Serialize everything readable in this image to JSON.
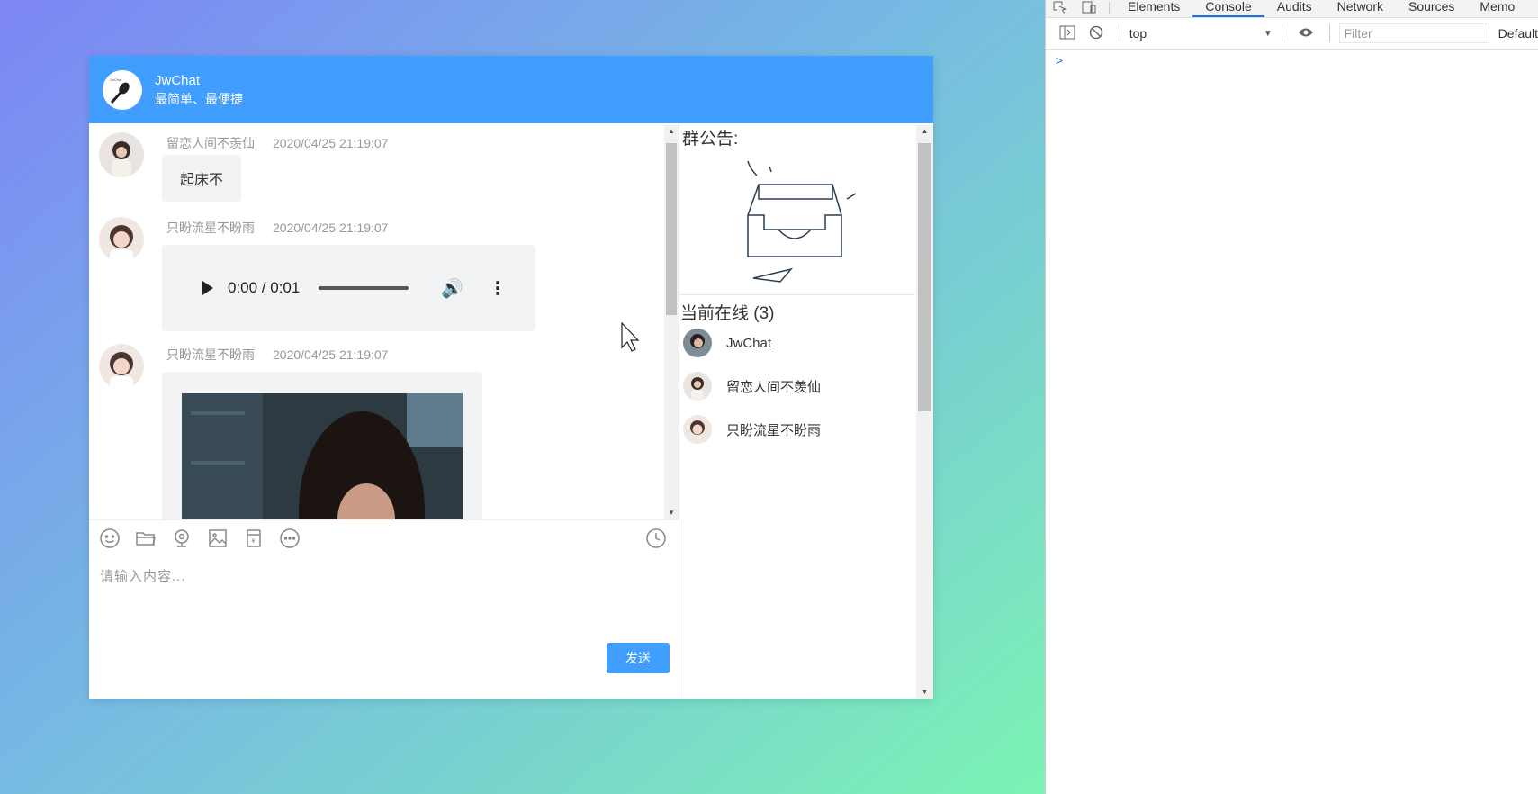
{
  "header": {
    "title": "JwChat",
    "subtitle": "最简单、最便捷"
  },
  "messages": [
    {
      "sender": "留恋人间不羡仙",
      "time": "2020/04/25 21:19:07",
      "type": "text",
      "text": "起床不"
    },
    {
      "sender": "只盼流星不盼雨",
      "time": "2020/04/25 21:19:07",
      "type": "audio",
      "audio_time": "0:00 / 0:01"
    },
    {
      "sender": "只盼流星不盼雨",
      "time": "2020/04/25 21:19:07",
      "type": "image"
    }
  ],
  "input": {
    "placeholder": "请输入内容..."
  },
  "send_label": "发送",
  "side": {
    "notice_title": "群公告:",
    "online_title": "当前在线 (3)",
    "users": [
      "JwChat",
      "留恋人间不羡仙",
      "只盼流星不盼雨"
    ]
  },
  "devtools": {
    "tabs": [
      "Elements",
      "Console",
      "Audits",
      "Network",
      "Sources",
      "Memo"
    ],
    "active_tab": "Console",
    "context": "top",
    "filter_placeholder": "Filter",
    "levels": "Default",
    "prompt": ">"
  },
  "colors": {
    "primary": "#409eff",
    "bubble": "#f2f3f5"
  }
}
